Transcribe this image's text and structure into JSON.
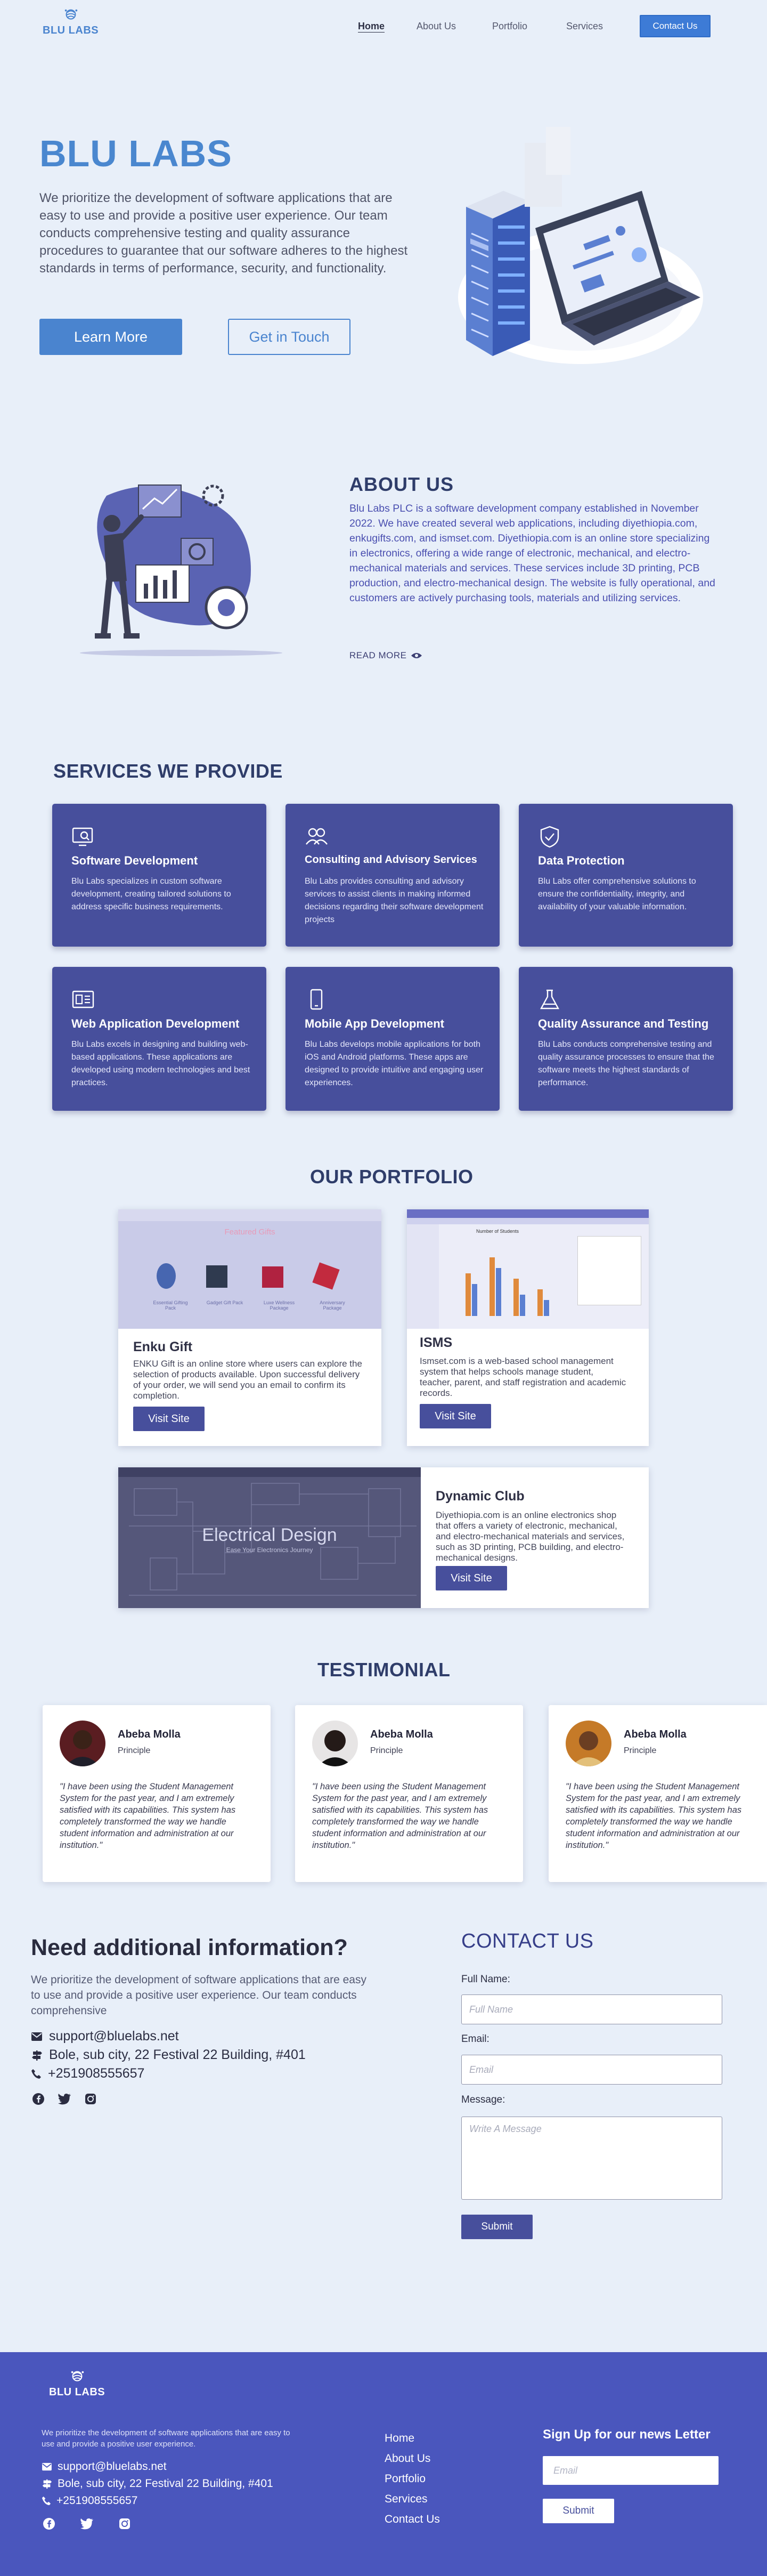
{
  "nav": {
    "logo_text": "BLU LABS",
    "links": [
      "Home",
      "About Us",
      "Portfolio",
      "Services"
    ],
    "contact_button": "Contact Us"
  },
  "hero": {
    "title": "BLU LABS",
    "description": "We prioritize the development of software applications that are easy to use and provide a positive user experience. Our team conducts comprehensive testing and quality assurance procedures to guarantee that our software adheres to the highest standards in terms of performance, security, and functionality.",
    "learn_more": "Learn More",
    "get_in_touch": "Get in Touch"
  },
  "about": {
    "title": "ABOUT US",
    "text": "Blu Labs PLC is a software development company established in November 2022. We have created several web applications, including diyethiopia.com, enkugifts.com, and ismset.com. Diyethiopia.com is an online store specializing in electronics, offering a wide range of electronic, mechanical, and electro-mechanical materials and services. These services include 3D printing, PCB production, and electro-mechanical design. The website is fully operational, and customers are actively purchasing tools, materials and utilizing services.",
    "read_more": "READ MORE"
  },
  "services": {
    "title": "SERVICES WE PROVIDE",
    "items": [
      {
        "icon": "monitor-search-icon",
        "title": "Software Development",
        "text": "Blu Labs specializes in custom software development, creating tailored solutions to address specific business requirements."
      },
      {
        "icon": "users-icon",
        "title": "Consulting and Advisory Services",
        "text": "Blu Labs provides consulting and advisory services to assist clients in making informed decisions regarding their software development projects"
      },
      {
        "icon": "shield-check-icon",
        "title": "Data Protection",
        "text": "Blu Labs offer comprehensive solutions to ensure the confidentiality, integrity, and availability of your valuable information."
      },
      {
        "icon": "web-window-icon",
        "title": "Web Application Development",
        "text": "Blu Labs excels in designing and building web-based applications. These applications are developed using modern technologies and best practices."
      },
      {
        "icon": "mobile-phone-icon",
        "title": "Mobile App Development",
        "text": "Blu Labs develops mobile applications for both iOS and Android platforms. These apps are designed to provide intuitive and engaging user experiences."
      },
      {
        "icon": "flask-icon",
        "title": "Quality Assurance and Testing",
        "text": "Blu Labs conducts comprehensive testing and quality assurance processes to ensure that the software meets the highest standards of performance."
      }
    ]
  },
  "portfolio": {
    "title": "OUR PORTFOLIO",
    "items": [
      {
        "title": "Enku Gift",
        "text": "ENKU Gift is an online store where users can explore the selection of products available. Upon successful delivery of your order, we will send you an email to confirm its completion.",
        "button": "Visit Site",
        "shot_heading": "Featured Gifts",
        "shot_items": [
          "Essential Gifting Pack",
          "Gadget Gift Pack",
          "Luxe Wellness Package",
          "Anniversary Package"
        ]
      },
      {
        "title": "ISMS",
        "text": "Ismset.com is a web-based school management system that helps schools manage student, teacher, parent, and staff registration and academic records.",
        "button": "Visit Site",
        "shot_heading": "Number of Students"
      },
      {
        "title": "Dynamic Club",
        "text": "Diyethiopia.com is an online electronics shop that offers a variety of electronic, mechanical, and electro-mechanical materials and services, such as 3D printing, PCB building, and electro-mechanical designs.",
        "button": "Visit Site",
        "shot_heading": "Electrical Design",
        "shot_sub": "Ease Your Electronics Journey"
      }
    ]
  },
  "testimonial": {
    "title": "TESTIMONIAL",
    "items": [
      {
        "name": "Abeba Molla",
        "role": "Principle",
        "quote": "\"I have been using the Student Management System for the past year, and I am extremely satisfied with its capabilities. This system has completely transformed the way we handle student information and administration at our institution.\""
      },
      {
        "name": "Abeba Molla",
        "role": "Principle",
        "quote": "\"I have been using the Student Management System for the past year, and I am extremely satisfied with its capabilities. This system has completely transformed the way we handle student information and administration at our institution.\""
      },
      {
        "name": "Abeba Molla",
        "role": "Principle",
        "quote": "\"I have been using the Student Management System for the past year, and I am extremely satisfied with its capabilities. This system has completely transformed the way we handle student information and administration at our institution.\""
      }
    ]
  },
  "info": {
    "title": "Need additional information?",
    "text": "We prioritize the development of software applications that are easy to use and provide a positive user experience. Our team conducts comprehensive",
    "email": "support@bluelabs.net",
    "address": "Bole, sub city, 22 Festival 22 Building, #401",
    "phone": "+251908555657"
  },
  "contact": {
    "title": "CONTACT US",
    "name_label": "Full Name:",
    "name_placeholder": "Full Name",
    "email_label": "Email:",
    "email_placeholder": "Email",
    "message_label": "Message:",
    "message_placeholder": "Write A Message",
    "submit": "Submit"
  },
  "footer": {
    "logo_text": "BLU LABS",
    "description": "We prioritize the development of software applications that are easy to use and provide a positive user experience.",
    "email": "support@bluelabs.net",
    "address": "Bole, sub city, 22 Festival 22 Building, #401",
    "phone": "+251908555657",
    "links": [
      "Home",
      "About Us",
      "Portfolio",
      "Services",
      "Contact Us"
    ],
    "newsletter_title": "Sign Up for our news Letter",
    "newsletter_placeholder": "Email",
    "newsletter_button": "Submit"
  },
  "colors": {
    "page_bg": "#e8eff9",
    "brand_blue": "#4a84cf",
    "card_indigo": "#474f9c",
    "footer_bg": "#4a56bd",
    "heading_navy": "#2f3d6a"
  }
}
